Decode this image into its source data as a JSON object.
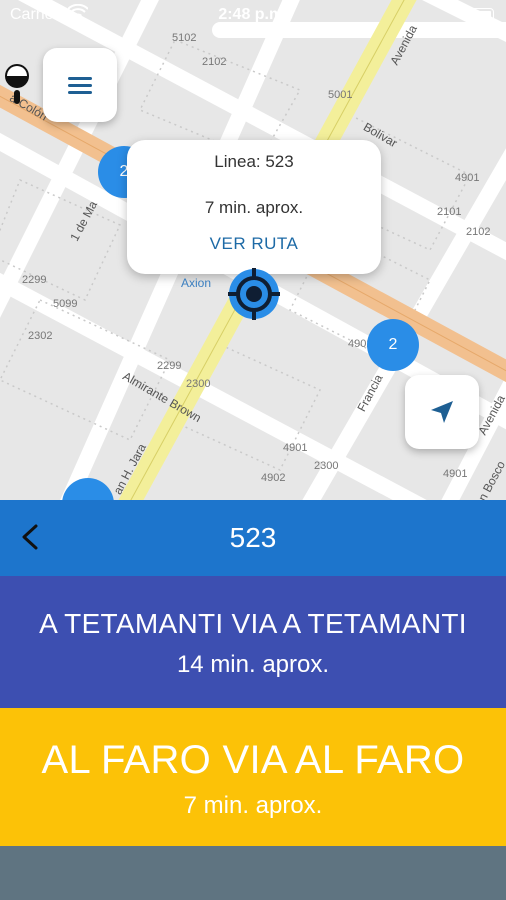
{
  "status_bar": {
    "carrier": "Carrier",
    "time": "2:48 p.m."
  },
  "map": {
    "popup": {
      "line": "Linea: 523",
      "eta": "7 min. aprox.",
      "link": "VER RUTA"
    },
    "poi": "Axion",
    "clusters": [
      "2",
      "2"
    ],
    "street_labels": [
      "Avenida",
      "Bolivar",
      "1 de Ma",
      "Almirante Brown",
      "Francia",
      "Avenida",
      "an H. Jara",
      "n Bosco",
      "a Colón"
    ],
    "block_numbers": [
      "5102",
      "2102",
      "5001",
      "4901",
      "2101",
      "2102",
      "2299",
      "5099",
      "2302",
      "2299",
      "2300",
      "4902",
      "4901",
      "2300",
      "4902",
      "4901"
    ],
    "icons": {
      "menu": "hamburger-menu-icon",
      "locate": "navigation-arrow-icon",
      "target": "crosshair-target-icon"
    }
  },
  "route": {
    "title": "523",
    "back_icon": "chevron-left-icon",
    "destinations": [
      {
        "name": "A TETAMANTI VIA A TETAMANTI",
        "time": "14 min. aprox.",
        "color": "#3d4fb1"
      },
      {
        "name": "AL FARO VIA AL FARO",
        "time": "7 min. aprox.",
        "color": "#fcc207"
      }
    ],
    "header_color": "#1d75cc"
  }
}
